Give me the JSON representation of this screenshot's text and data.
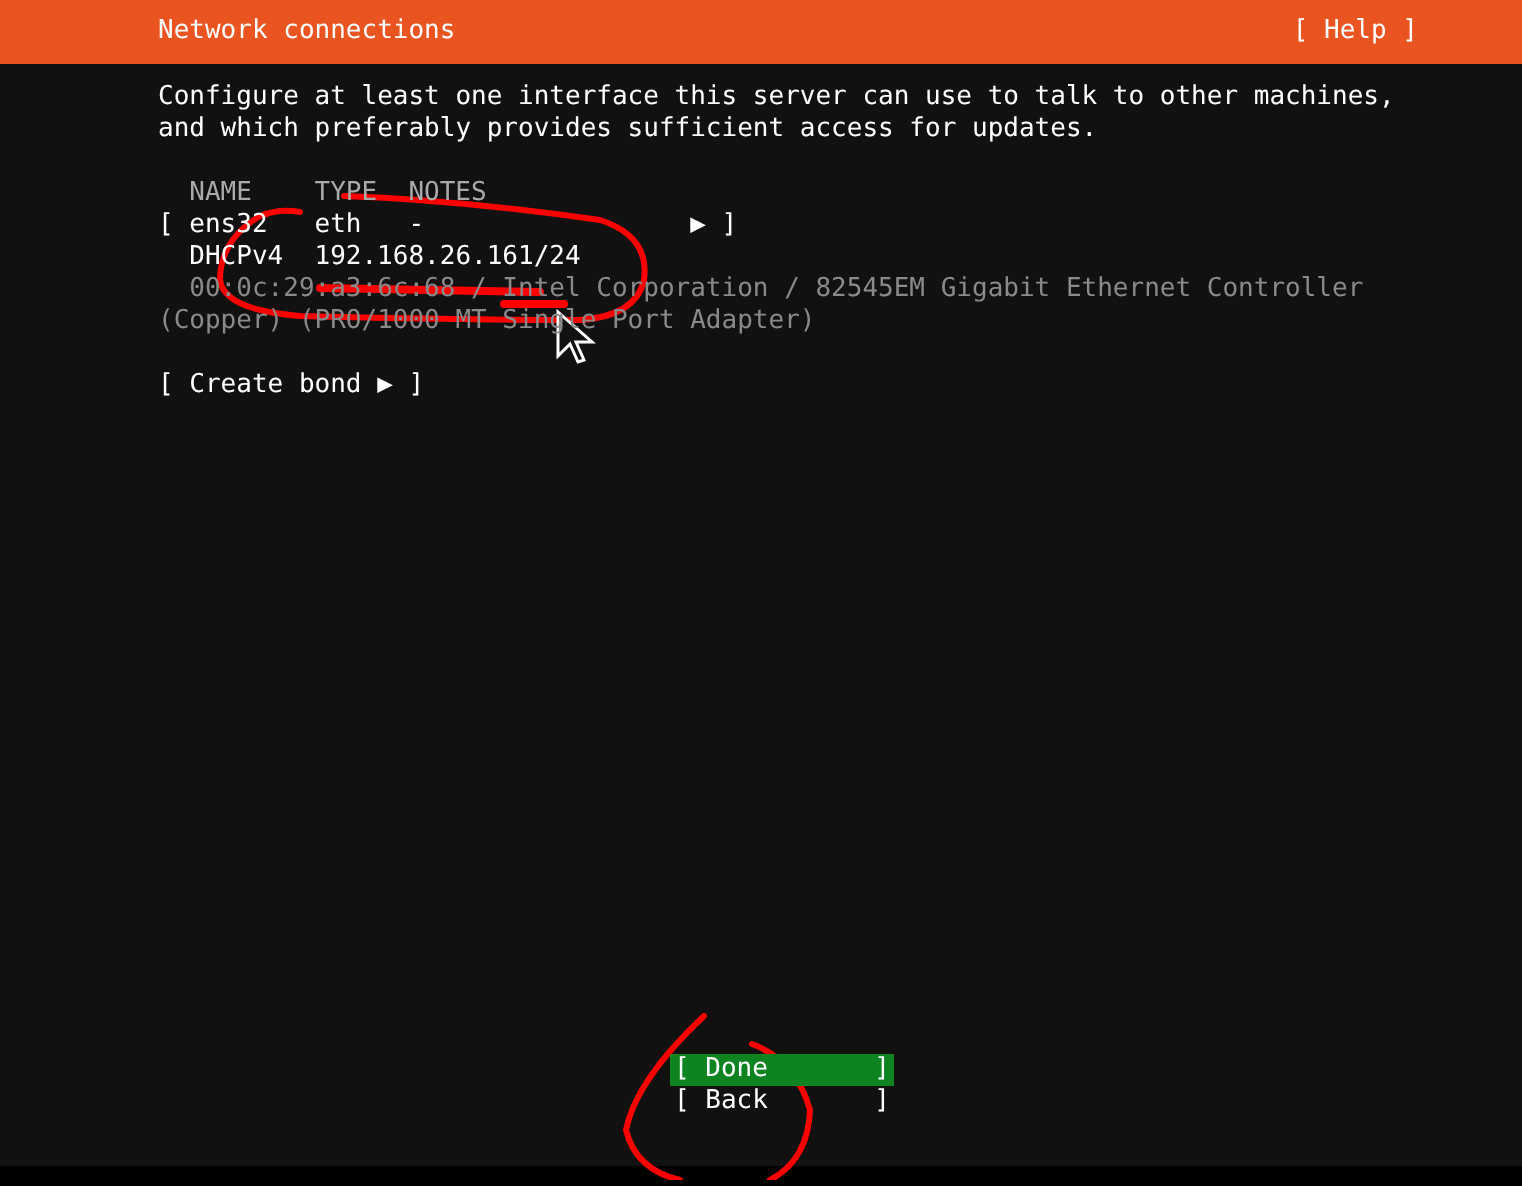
{
  "header": {
    "title": "Network connections",
    "help": "[ Help ]"
  },
  "description": "Configure at least one interface this server can use to talk to other machines,\nand which preferably provides sufficient access for updates.",
  "table": {
    "columns": [
      "NAME",
      "TYPE",
      "NOTES"
    ],
    "interfaces": [
      {
        "open": "[",
        "name": "ens32",
        "type": "eth",
        "notes": "-",
        "arrow": "▶",
        "close": "]",
        "address_method": "DHCPv4",
        "address": "192.168.26.161/24",
        "details": "00:0c:29:a3:6c:68 / Intel Corporation / 82545EM Gigabit Ethernet Controller\n(Copper) (PRO/1000 MT Single Port Adapter)"
      }
    ]
  },
  "create_bond": "[ Create bond ▶ ]",
  "buttons": [
    {
      "open": "[",
      "label": "Done",
      "close": "]",
      "selected": true
    },
    {
      "open": "[",
      "label": "Back",
      "close": "]",
      "selected": false
    }
  ]
}
